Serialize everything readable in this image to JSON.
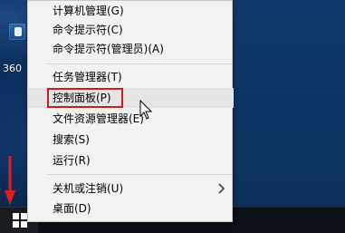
{
  "desktop": {
    "partial_icon_label": "360"
  },
  "menu": {
    "items": [
      {
        "label": "计算机管理(G)",
        "highlighted": false,
        "has_submenu": false
      },
      {
        "label": "命令提示符(C)",
        "highlighted": false,
        "has_submenu": false
      },
      {
        "label": "命令提示符(管理员)(A)",
        "highlighted": false,
        "has_submenu": false
      },
      {
        "label": "任务管理器(T)",
        "highlighted": false,
        "has_submenu": false
      },
      {
        "label": "控制面板(P)",
        "highlighted": true,
        "has_submenu": false
      },
      {
        "label": "文件资源管理器(E)",
        "highlighted": false,
        "has_submenu": false
      },
      {
        "label": "搜索(S)",
        "highlighted": false,
        "has_submenu": false
      },
      {
        "label": "运行(R)",
        "highlighted": false,
        "has_submenu": false
      },
      {
        "label": "关机或注销(U)",
        "highlighted": false,
        "has_submenu": true
      },
      {
        "label": "桌面(D)",
        "highlighted": false,
        "has_submenu": false
      }
    ]
  },
  "annotations": {
    "highlight_color": "#d11a1a",
    "arrow_color": "#e02020"
  },
  "icons": {
    "start": "windows-logo-icon",
    "submenu": "chevron-right-icon",
    "cursor": "mouse-pointer-icon",
    "desktop_app": "app-shortcut-icon"
  }
}
